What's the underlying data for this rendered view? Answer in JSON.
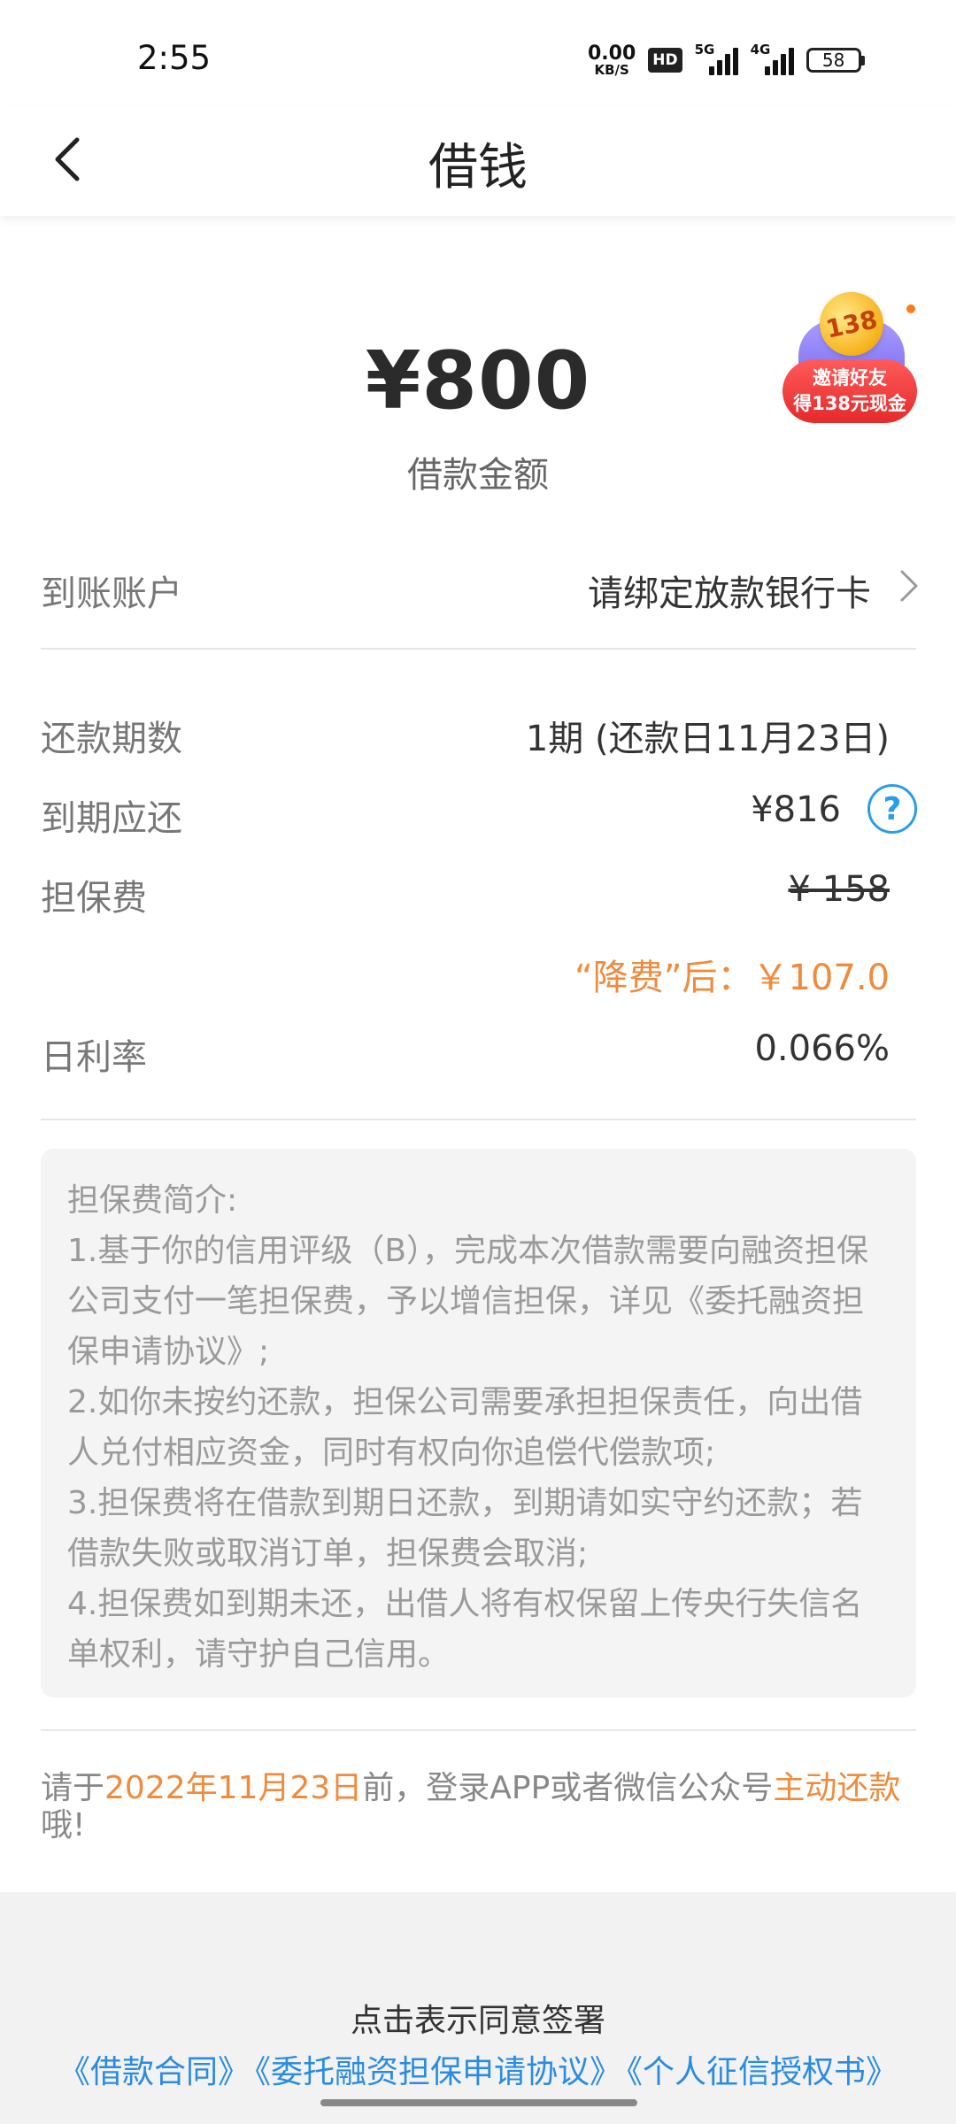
{
  "status_bar": {
    "time": "2:55",
    "net_speed_value": "0.00",
    "net_speed_unit": "KB/S",
    "hd_label": "HD",
    "signal1_label": "5G",
    "signal2_label": "4G",
    "battery": "58"
  },
  "nav": {
    "back_icon": "chevron-left-icon",
    "title": "借钱"
  },
  "loan": {
    "amount": "¥800",
    "amount_label": "借款金额"
  },
  "promo": {
    "coin_text": "138",
    "line1": "邀请好友",
    "line2": "得138元现金"
  },
  "account_row": {
    "label": "到账账户",
    "value": "请绑定放款银行卡"
  },
  "details": {
    "periods_label": "还款期数",
    "periods_value": "1期 (还款日11月23日)",
    "due_label": "到期应还",
    "due_value": "¥816",
    "help_icon": "?",
    "fee_label": "担保费",
    "fee_original": "¥ 158",
    "fee_discount": "“降费”后：￥107.0",
    "rate_label": "日利率",
    "rate_value": "0.066%"
  },
  "fee_info": {
    "title": "担保费简介:",
    "items": [
      "1.基于你的信用评级（B），完成本次借款需要向融资担保公司支付一笔担保费，予以增信担保，详见《委托融资担保申请协议》;",
      "2.如你未按约还款，担保公司需要承担担保责任，向出借人兑付相应资金，同时有权向你追偿代偿款项;",
      "3.担保费将在借款到期日还款，到期请如实守约还款；若借款失败或取消订单，担保费会取消;",
      "4.担保费如到期未还，出借人将有权保留上传央行失信名单权利，请守护自己信用。"
    ]
  },
  "notice": {
    "part1": "请于",
    "date": "2022年11月23日",
    "part2": "前，登录APP或者微信公众号",
    "action": "主动还款",
    "part3": "哦!"
  },
  "footer": {
    "agree_text": "点击表示同意签署",
    "links": [
      "《借款合同》",
      "《委托融资担保申请协议》",
      "《个人征信授权书》"
    ]
  }
}
